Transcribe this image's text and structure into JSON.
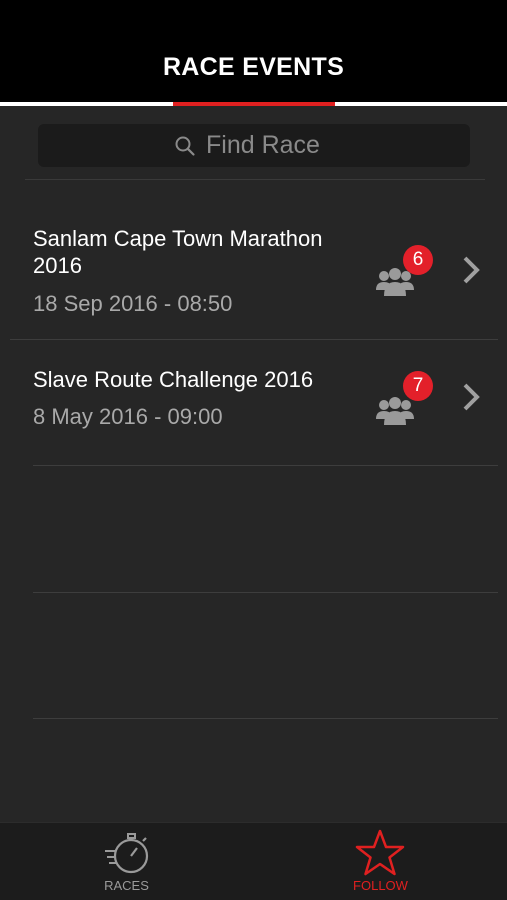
{
  "header": {
    "title": "RACE EVENTS"
  },
  "search": {
    "placeholder": "Find Race",
    "value": ""
  },
  "races": [
    {
      "name": "Sanlam Cape Town Marathon 2016",
      "date": "18 Sep 2016 - 08:50",
      "followers": "6"
    },
    {
      "name": "Slave Route Challenge 2016",
      "date": "8 May 2016 - 09:00",
      "followers": "7"
    }
  ],
  "tabs": [
    {
      "label": "RACES",
      "icon": "stopwatch-icon",
      "active": false
    },
    {
      "label": "FOLLOW",
      "icon": "star-icon",
      "active": true
    }
  ],
  "colors": {
    "accent": "#e02020",
    "badge": "#e3202a",
    "background": "#262626",
    "header": "#000000",
    "inactive_tab": "#9a9a9a"
  }
}
